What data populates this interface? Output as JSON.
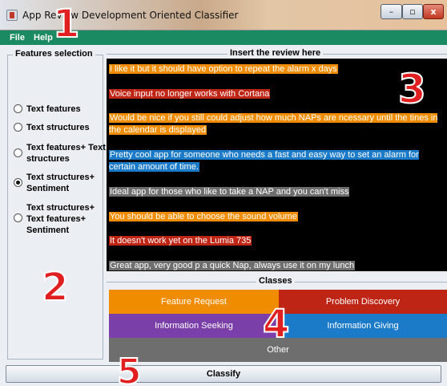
{
  "window": {
    "title": "App Review Development Oriented Classifier",
    "buttons": {
      "minimize": "–",
      "maximize": "▫",
      "close": "x"
    }
  },
  "menu": {
    "items": [
      "File",
      "Help"
    ]
  },
  "features": {
    "title": "Features selection",
    "options": [
      {
        "label": "Text features",
        "checked": false
      },
      {
        "label": "Text structures",
        "checked": false
      },
      {
        "label": "Text features+ Text structures",
        "checked": false
      },
      {
        "label": "Text structures+ Sentiment",
        "checked": true
      },
      {
        "label": "Text structures+ Text features+ Sentiment",
        "checked": false
      }
    ]
  },
  "review": {
    "title": "Insert the review here",
    "items": [
      {
        "text": "I like it but it should have option to repeat the alarm x days",
        "color": "#f08c00"
      },
      {
        "text": "Voice input no longer works with Cortana",
        "color": "#bf2515"
      },
      {
        "text": "Would be nice if you still could adjust how much NAPs are ncessary until the tines in the calendar is displayed",
        "color": "#f08c00"
      },
      {
        "text": "Pretty cool app for someone who needs a fast and easy way to set an alarm for certain amount of time.",
        "color": "#1c7bc9"
      },
      {
        "text": "Ideal app for those who like to take a NAP and you can't miss",
        "color": "#6e6e6e"
      },
      {
        "text": "You should be able to choose the sound volume",
        "color": "#f08c00"
      },
      {
        "text": "It doesn't work yet on the Lumia 735",
        "color": "#bf2515"
      },
      {
        "text": "Great app, very good p a quick Nap, always use it on my lunch",
        "color": "#6e6e6e"
      }
    ]
  },
  "classes": {
    "title": "Classes",
    "feature_request": "Feature Request",
    "problem_discovery": "Problem Discovery",
    "information_seeking": "Information Seeking",
    "information_giving": "Information Giving",
    "other": "Other",
    "colors": {
      "feature_request": "#f08c00",
      "problem_discovery": "#bf2515",
      "information_seeking": "#7a3fa8",
      "information_giving": "#1c7bc9",
      "other": "#6e6e6e"
    }
  },
  "classify_button": "Classify",
  "annotations": [
    "1",
    "2",
    "3",
    "4",
    "5"
  ]
}
